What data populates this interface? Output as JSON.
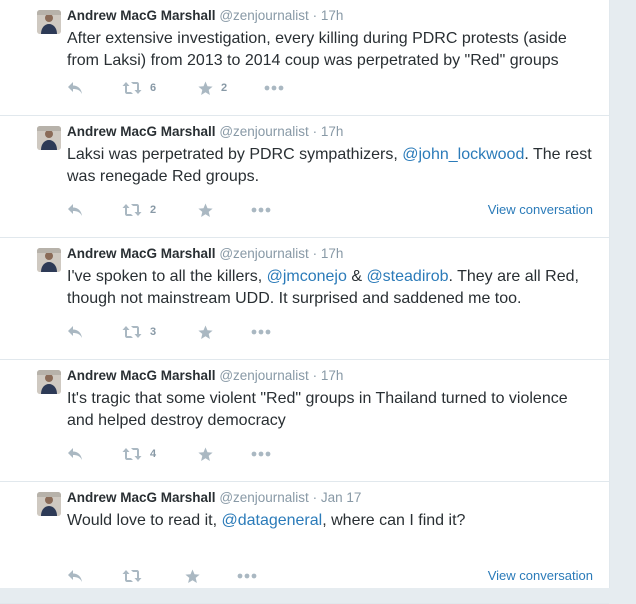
{
  "tweets": [
    {
      "fullname": "Andrew MacG Marshall",
      "username": "@zenjournalist",
      "separator": "·",
      "time": "17h",
      "text_parts": [
        "After extensive investigation, every killing during PDRC protests (aside from Laksi) from 2013 to 2014 coup was perpetrated by \"Red\" groups"
      ],
      "retweet_count": "6",
      "favorite_count": "2",
      "view_conversation": ""
    },
    {
      "fullname": "Andrew MacG Marshall",
      "username": "@zenjournalist",
      "separator": "·",
      "time": "17h",
      "text_parts": [
        "Laksi was perpetrated by PDRC sympathizers, ",
        ". The rest was renegade Red groups."
      ],
      "mentions": [
        "@john_lockwood"
      ],
      "retweet_count": "2",
      "favorite_count": "",
      "view_conversation": "View conversation"
    },
    {
      "fullname": "Andrew MacG Marshall",
      "username": "@zenjournalist",
      "separator": "·",
      "time": "17h",
      "text_parts": [
        "I've spoken to all the killers, ",
        " & ",
        ". They are all Red, though not mainstream UDD. It surprised and saddened me too."
      ],
      "mentions": [
        "@jmconejo",
        "@steadirob"
      ],
      "retweet_count": "3",
      "favorite_count": "",
      "view_conversation": ""
    },
    {
      "fullname": "Andrew MacG Marshall",
      "username": "@zenjournalist",
      "separator": "·",
      "time": "17h",
      "text_parts": [
        "It's tragic that some violent \"Red\" groups in Thailand turned to violence and helped destroy democracy"
      ],
      "retweet_count": "4",
      "favorite_count": "",
      "view_conversation": ""
    },
    {
      "fullname": "Andrew MacG Marshall",
      "username": "@zenjournalist",
      "separator": "·",
      "time": "Jan 17",
      "text_parts": [
        "Would love to read it, ",
        ", where can I find it?"
      ],
      "mentions": [
        "@datageneral"
      ],
      "retweet_count": "",
      "favorite_count": "",
      "view_conversation": "View conversation"
    }
  ],
  "icons": {
    "reply": "reply-icon",
    "retweet": "retweet-icon",
    "favorite": "star-icon",
    "more": "more-icon"
  },
  "colors": {
    "link": "#2b7bb9",
    "muted": "#8899a6",
    "icon": "#aab8c2",
    "text": "#292f33",
    "border": "#e1e8ed",
    "background": "#e6ecf0"
  }
}
